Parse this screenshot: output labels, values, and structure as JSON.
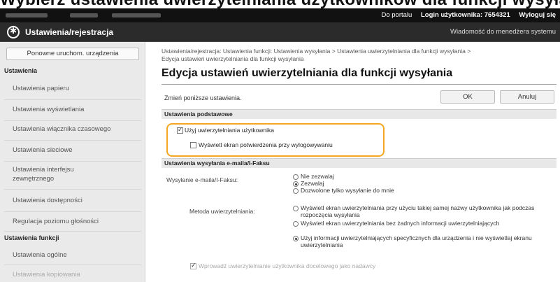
{
  "heading": {
    "text": "Wybierz ustawienia uwierzytelniania użytkowników dla funkcji wysyłania. Kliknij [OK] aby zapisać"
  },
  "topbar": {
    "portal_label": "Do portalu",
    "login_label": "Login użytkownika:",
    "login_value": "7654321",
    "logout_label": "Wyloguj się"
  },
  "titlebar": {
    "title": "Ustawienia/rejestracja",
    "message": "Wiadomość do menedżera systemu"
  },
  "sidebar": {
    "restart_button": "Ponowne uruchom. urządzenia",
    "section_settings": "Ustawienia",
    "items": [
      "Ustawienia papieru",
      "Ustawienia wyświetlania",
      "Ustawienia włącznika czasowego",
      "Ustawienia sieciowe",
      "Ustawienia interfejsu zewnętrznego",
      "Ustawienia dostępności",
      "Regulacja poziomu głośności"
    ],
    "section_functions": "Ustawienia funkcji",
    "function_items": [
      "Ustawienia ogólne",
      "Ustawienia kopiowania"
    ]
  },
  "main": {
    "breadcrumb_line1": "Ustawienia/rejestracja: Ustawienia funkcji: Ustawienia wysyłania > Ustawienia uwierzytelniania dla funkcji wysyłania >",
    "breadcrumb_line2": "Edycja ustawień uwierzytelniania dla funkcji wysyłania",
    "title": "Edycja ustawień uwierzytelniania dla funkcji wysyłania",
    "instruction": "Zmień poniższe ustawienia.",
    "ok_label": "OK",
    "cancel_label": "Anuluj",
    "section_basic": "Ustawienia podstawowe",
    "use_auth_label": "Użyj uwierzytelniania użytkownika",
    "use_auth_checked": true,
    "confirm_logout_label": "Wyświetl ekran potwierdzenia przy wylogowywaniu",
    "confirm_logout_checked": false,
    "section_send": "Ustawienia wysyłania e-maila/I-Faksu",
    "send_label": "Wysyłanie e-maila/I-Faksu:",
    "send_options": [
      "Nie zezwalaj",
      "Zezwalaj",
      "Dozwolone tylko wysyłanie do mnie"
    ],
    "send_selected": 1,
    "auth_method_label": "Metoda uwierzytelniania:",
    "auth_options": [
      "Wyświetl ekran uwierzytelniania przy użyciu takiej samej nazwy użytkownika jak podczas rozpoczęcia wysyłania",
      "Wyświetl ekran uwierzytelniania bez żadnych informacji uwierzytelniających",
      "Użyj informacji uwierzytelniających specyficznych dla urządzenia i nie wyświetlaj ekranu uwierzytelniania"
    ],
    "auth_selected": 2,
    "bottom_checkbox_label": "Wprowadź uwierzytelnianie użytkownika docelowego jako nadawcy"
  }
}
